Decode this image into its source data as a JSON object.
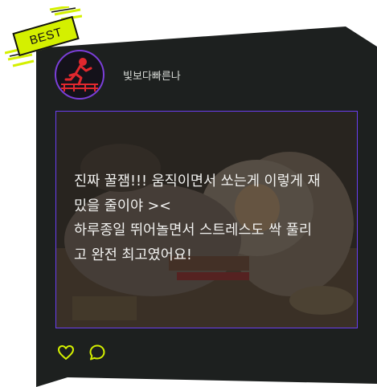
{
  "badge": {
    "label": "BEST"
  },
  "author": {
    "name": "빛보다빠른나"
  },
  "post": {
    "text": "진짜 꿀잼!!! 움직이면서 쏘는게 이렇게 재\n밌을 줄이야 ><\n하루종일 뛰어놀면서 스트레스도 싹 풀리\n고 완전 최고였어요!"
  },
  "actions": {
    "like_icon": "heart-icon",
    "comment_icon": "comment-icon"
  },
  "colors": {
    "card_bg": "#1d201f",
    "accent_lime": "#d4f000",
    "border_purple": "#6a3ef0",
    "avatar_red": "#e0282e"
  }
}
